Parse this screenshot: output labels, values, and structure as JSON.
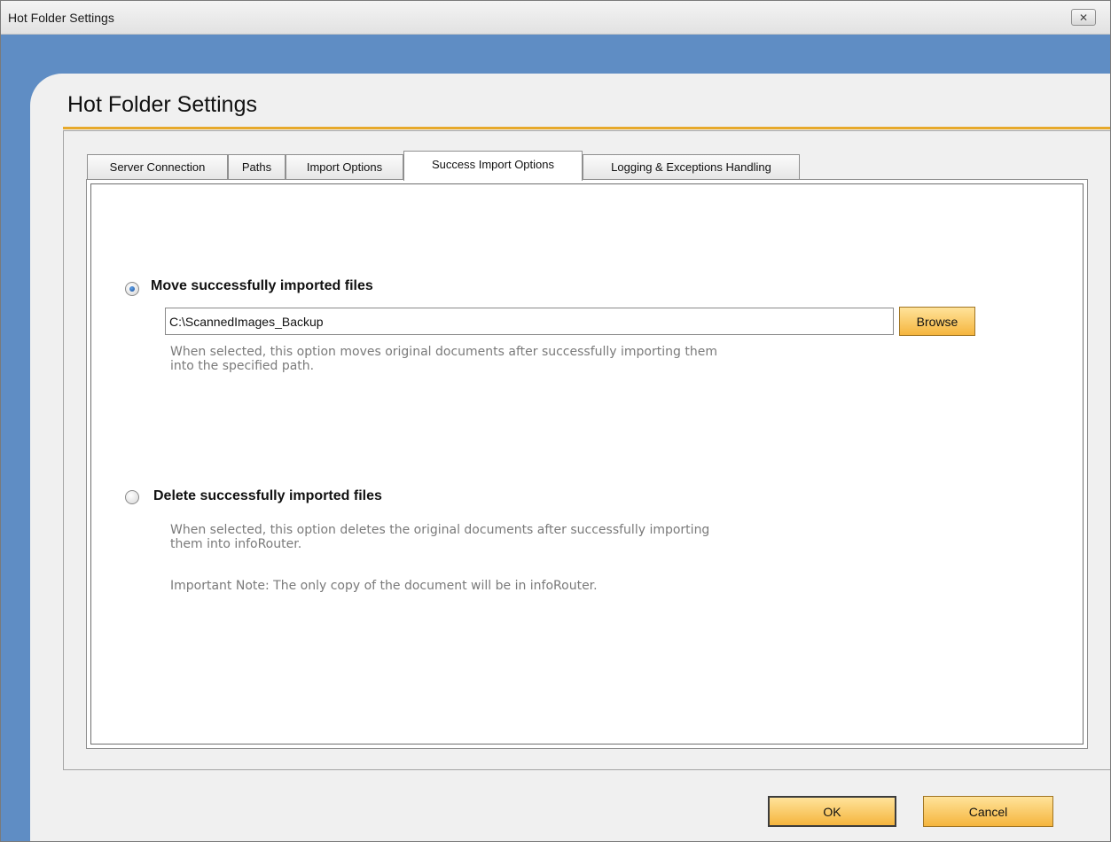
{
  "window": {
    "title": "Hot Folder Settings",
    "close_glyph": "✕"
  },
  "heading": "Hot Folder Settings",
  "tabs": [
    {
      "label": "Server Connection",
      "active": false
    },
    {
      "label": "Paths",
      "active": false
    },
    {
      "label": "Import Options",
      "active": false
    },
    {
      "label": "Success Import Options",
      "active": true
    },
    {
      "label": "Logging & Exceptions Handling",
      "active": false
    }
  ],
  "options": {
    "move": {
      "label": "Move successfully imported files",
      "selected": true,
      "path_value": "C:\\ScannedImages_Backup",
      "browse_label": "Browse",
      "description_line1": "When selected, this option moves original documents after successfully importing them",
      "description_line2": "into the specified path."
    },
    "delete": {
      "label": "Delete successfully imported files",
      "selected": false,
      "description_line1": "When selected, this option deletes the original documents after successfully importing",
      "description_line2": "them into infoRouter.",
      "note": "Important Note: The only copy of the document will be in infoRouter."
    }
  },
  "footer": {
    "ok_label": "OK",
    "cancel_label": "Cancel"
  },
  "colors": {
    "frame_blue": "#5f8dc4",
    "accent_orange": "#e7a92b",
    "button_orange": "#f5b53d"
  }
}
